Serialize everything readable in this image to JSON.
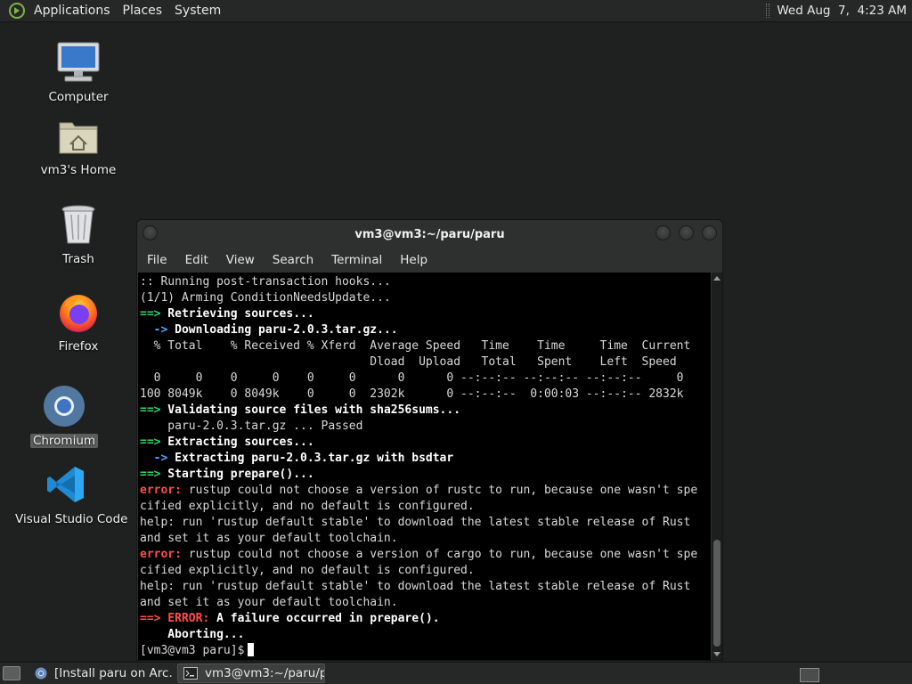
{
  "top_panel": {
    "menus": [
      "Applications",
      "Places",
      "System"
    ],
    "clock": "Wed Aug  7,  4:23 AM"
  },
  "desktop_icons": [
    {
      "label": "Computer",
      "icon": "computer-icon"
    },
    {
      "label": "vm3's Home",
      "icon": "home-folder-icon"
    },
    {
      "label": "Trash",
      "icon": "trash-icon"
    },
    {
      "label": "Firefox",
      "icon": "firefox-icon"
    },
    {
      "label": "Chromium",
      "icon": "chromium-icon"
    },
    {
      "label": "Visual Studio Code",
      "icon": "vscode-icon"
    }
  ],
  "terminal": {
    "title": "vm3@vm3:~/paru/paru",
    "menus": [
      "File",
      "Edit",
      "View",
      "Search",
      "Terminal",
      "Help"
    ],
    "lines": [
      {
        "text": ":: Running post-transaction hooks..."
      },
      {
        "text": "(1/1) Arming ConditionNeedsUpdate..."
      },
      {
        "prefix": "==>",
        "prefix_color": "green",
        "text": " Retrieving sources...",
        "bold": true
      },
      {
        "prefix": "  ->",
        "prefix_color": "blue",
        "text": " Downloading paru-2.0.3.tar.gz...",
        "bold": true
      },
      {
        "text": "  % Total    % Received % Xferd  Average Speed   Time    Time     Time  Current"
      },
      {
        "text": "                                 Dload  Upload   Total   Spent    Left  Speed"
      },
      {
        "text": "  0     0    0     0    0     0      0      0 --:--:-- --:--:-- --:--:--     0"
      },
      {
        "text": "100 8049k    0 8049k    0     0  2302k      0 --:--:--  0:00:03 --:--:-- 2832k"
      },
      {
        "prefix": "==>",
        "prefix_color": "green",
        "text": " Validating source files with sha256sums...",
        "bold": true
      },
      {
        "text": "    paru-2.0.3.tar.gz ... Passed"
      },
      {
        "prefix": "==>",
        "prefix_color": "green",
        "text": " Extracting sources...",
        "bold": true
      },
      {
        "prefix": "  ->",
        "prefix_color": "blue",
        "text": " Extracting paru-2.0.3.tar.gz with bsdtar",
        "bold": true
      },
      {
        "prefix": "==>",
        "prefix_color": "green",
        "text": " Starting prepare()...",
        "bold": true
      },
      {
        "prefix": "error:",
        "prefix_color": "red",
        "text": " rustup could not choose a version of rustc to run, because one wasn't spe"
      },
      {
        "text": "cified explicitly, and no default is configured."
      },
      {
        "text": "help: run 'rustup default stable' to download the latest stable release of Rust"
      },
      {
        "text": "and set it as your default toolchain."
      },
      {
        "prefix": "error:",
        "prefix_color": "red",
        "text": " rustup could not choose a version of cargo to run, because one wasn't spe"
      },
      {
        "text": "cified explicitly, and no default is configured."
      },
      {
        "text": "help: run 'rustup default stable' to download the latest stable release of Rust"
      },
      {
        "text": "and set it as your default toolchain."
      },
      {
        "prefix": "==> ERROR:",
        "prefix_color": "red",
        "text": " A failure occurred in prepare().",
        "bold": true
      },
      {
        "text": "    Aborting...",
        "bold": true
      },
      {
        "text": "[vm3@vm3 paru]$",
        "prompt": true
      }
    ]
  },
  "taskbar": {
    "tasks": [
      {
        "label": "[Install paru on Arc...",
        "icon": "chromium-icon",
        "active": false
      },
      {
        "label": "vm3@vm3:~/paru/p...",
        "icon": "terminal-icon",
        "active": true
      }
    ]
  },
  "colors": {
    "green": "#2fd36f",
    "blue": "#4aa7ff",
    "red": "#ff4d4d",
    "panel": "#262827",
    "desktop": "#1f2120"
  }
}
